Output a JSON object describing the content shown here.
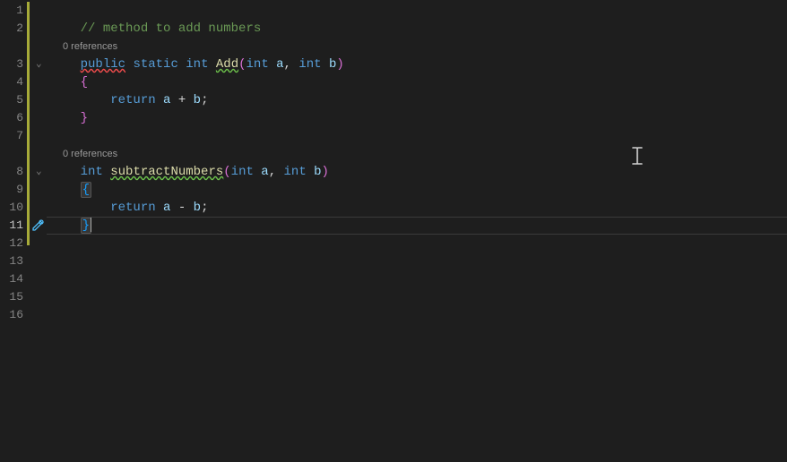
{
  "lineNumbers": [
    "1",
    "2",
    "",
    "3",
    "4",
    "5",
    "6",
    "7",
    "",
    "8",
    "9",
    "10",
    "11",
    "12",
    "13",
    "14",
    "15",
    "16"
  ],
  "activeLineIndex": 12,
  "changedBar": {
    "topPx": 2,
    "heightPx": 272
  },
  "codelens1": "0 references",
  "codelens2": "0 references",
  "code": {
    "l2_comment": "// method to add numbers",
    "l3": {
      "pub": "public",
      "stat": "static",
      "typ": "int",
      "fn": "Add",
      "lp": "(",
      "t1": "int",
      "a": "a",
      "c": ",",
      "t2": "int",
      "b": "b",
      "rp": ")"
    },
    "l4_brace": "{",
    "l5": {
      "ret": "return",
      "a": "a",
      "op": "+",
      "b": "b",
      "sc": ";"
    },
    "l6_brace": "}",
    "l8": {
      "typ": "int",
      "fn": "subtractNumbers",
      "lp": "(",
      "t1": "int",
      "a": "a",
      "c": ",",
      "t2": "int",
      "b": "b",
      "rp": ")"
    },
    "l9_brace": "{",
    "l10": {
      "ret": "return",
      "a": "a",
      "op": "-",
      "b": "b",
      "sc": ";"
    },
    "l11_brace": "}"
  },
  "icons": {
    "brush": "brush-icon",
    "fold": "chevron-down-icon",
    "textCursor": "text-cursor"
  }
}
